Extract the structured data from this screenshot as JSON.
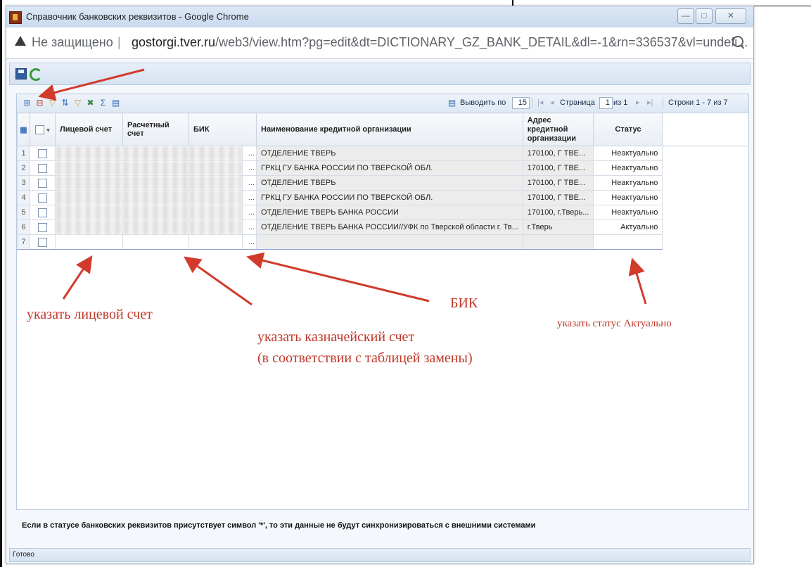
{
  "window": {
    "title": "Справочник банковских реквизитов - Google Chrome",
    "controls": {
      "minimize": "—",
      "maximize": "□",
      "close": "✕"
    }
  },
  "addressbar": {
    "security": "Не защищено",
    "separator": "|",
    "url_host": "gostorgi.tver.ru",
    "url_path": "/web3/view.htm?pg=edit&dt=DICTIONARY_GZ_BANK_DETAIL&dl=-1&rn=336537&vl=undefi..."
  },
  "pager": {
    "show_label": "Выводить по",
    "page_size": "15",
    "page_label": "Страница",
    "page_value": "1",
    "page_of": "из 1",
    "rows_label": "Строки 1 - 7 из 7"
  },
  "grid": {
    "headers": {
      "account": "Лицевой счет",
      "settlement": "Расчетный счет",
      "bik": "БИК",
      "org": "Наименование кредитной организации",
      "address": "Адрес кредитной организации",
      "status": "Статус"
    },
    "rows": [
      {
        "n": "1",
        "org": "ОТДЕЛЕНИЕ ТВЕРЬ",
        "address": "170100, Г ТВЕ...",
        "status": "Неактуально"
      },
      {
        "n": "2",
        "org": "ГРКЦ ГУ БАНКА РОССИИ ПО ТВЕРСКОЙ ОБЛ.",
        "address": "170100, Г ТВЕ...",
        "status": "Неактуально"
      },
      {
        "n": "3",
        "org": "ОТДЕЛЕНИЕ ТВЕРЬ",
        "address": "170100, Г ТВЕ...",
        "status": "Неактуально"
      },
      {
        "n": "4",
        "org": "ГРКЦ ГУ БАНКА РОССИИ ПО ТВЕРСКОЙ ОБЛ.",
        "address": "170100, Г ТВЕ...",
        "status": "Неактуально"
      },
      {
        "n": "5",
        "org": "ОТДЕЛЕНИЕ ТВЕРЬ БАНКА РОССИИ",
        "address": "170100, г.Тверь...",
        "status": "Неактуально"
      },
      {
        "n": "6",
        "org": "ОТДЕЛЕНИЕ ТВЕРЬ БАНКА РОССИИ//УФК по Тверской области г. Тв...",
        "address": "г.Тверь",
        "status": "Актуально"
      },
      {
        "n": "7",
        "org": "",
        "address": "",
        "status": ""
      }
    ],
    "ellipsis": "..."
  },
  "footer_note": "Если в статусе банковских реквизитов присутствует символ '*', то эти данные не будут синхронизироваться с внешними системами",
  "status_bar": "Готово",
  "annotations": {
    "account": "указать лицевой счет",
    "treasury_line1": "указать казначейский счет",
    "treasury_line2": "(в соответствии с таблицей замены)",
    "bik": "БИК",
    "status": "указать статус Актуально",
    "color": "#c0392b"
  }
}
